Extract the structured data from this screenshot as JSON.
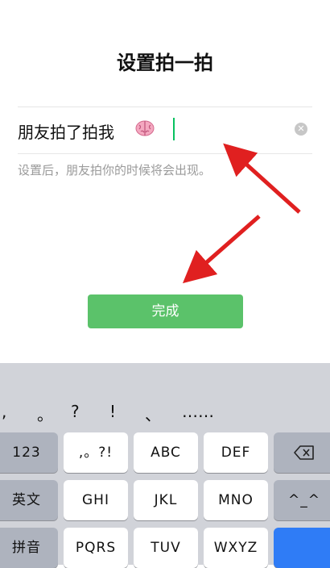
{
  "title": "设置拍一拍",
  "input": {
    "value": "朋友拍了拍我",
    "emoji": "brain-emoji",
    "clear_icon": "clear-icon"
  },
  "hint": "设置后，朋友拍你的时候将会出现。",
  "done_label": "完成",
  "keyboard": {
    "candidates": [
      ",",
      "。",
      "?",
      "!",
      "、",
      "……"
    ],
    "row1": {
      "left": "123",
      "keys": [
        ",。?!",
        "ABC",
        "DEF"
      ],
      "right_icon": "backspace-icon"
    },
    "row2": {
      "left": "英文",
      "keys": [
        "GHI",
        "JKL",
        "MNO"
      ],
      "right": "^_^"
    },
    "row3": {
      "left": "拼音",
      "keys": [
        "PQRS",
        "TUV",
        "WXYZ"
      ]
    }
  },
  "colors": {
    "accent_green": "#5bc26a",
    "caret": "#07c160",
    "annotation_arrow": "#e02020",
    "keyboard_bg": "#d1d3d9"
  }
}
